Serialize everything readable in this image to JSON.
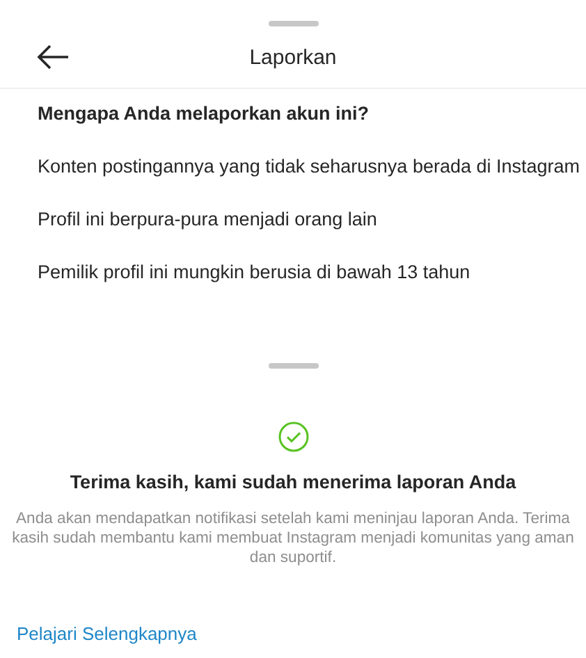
{
  "report_sheet": {
    "title": "Laporkan",
    "question": "Mengapa Anda melaporkan akun ini?",
    "options": [
      {
        "label": "Konten postingannya yang tidak seharusnya berada di Instagram"
      },
      {
        "label": "Profil ini berpura-pura menjadi orang lain"
      },
      {
        "label": "Pemilik profil ini mungkin berusia di bawah 13 tahun"
      }
    ]
  },
  "confirmation_sheet": {
    "title": "Terima kasih, kami sudah menerima laporan Anda",
    "message": "Anda akan mendapatkan notifikasi setelah kami meninjau laporan Anda. Terima kasih sudah membantu kami membuat Instagram menjadi komunitas yang aman dan suportif.",
    "link": "Pelajari Selengkapnya"
  }
}
